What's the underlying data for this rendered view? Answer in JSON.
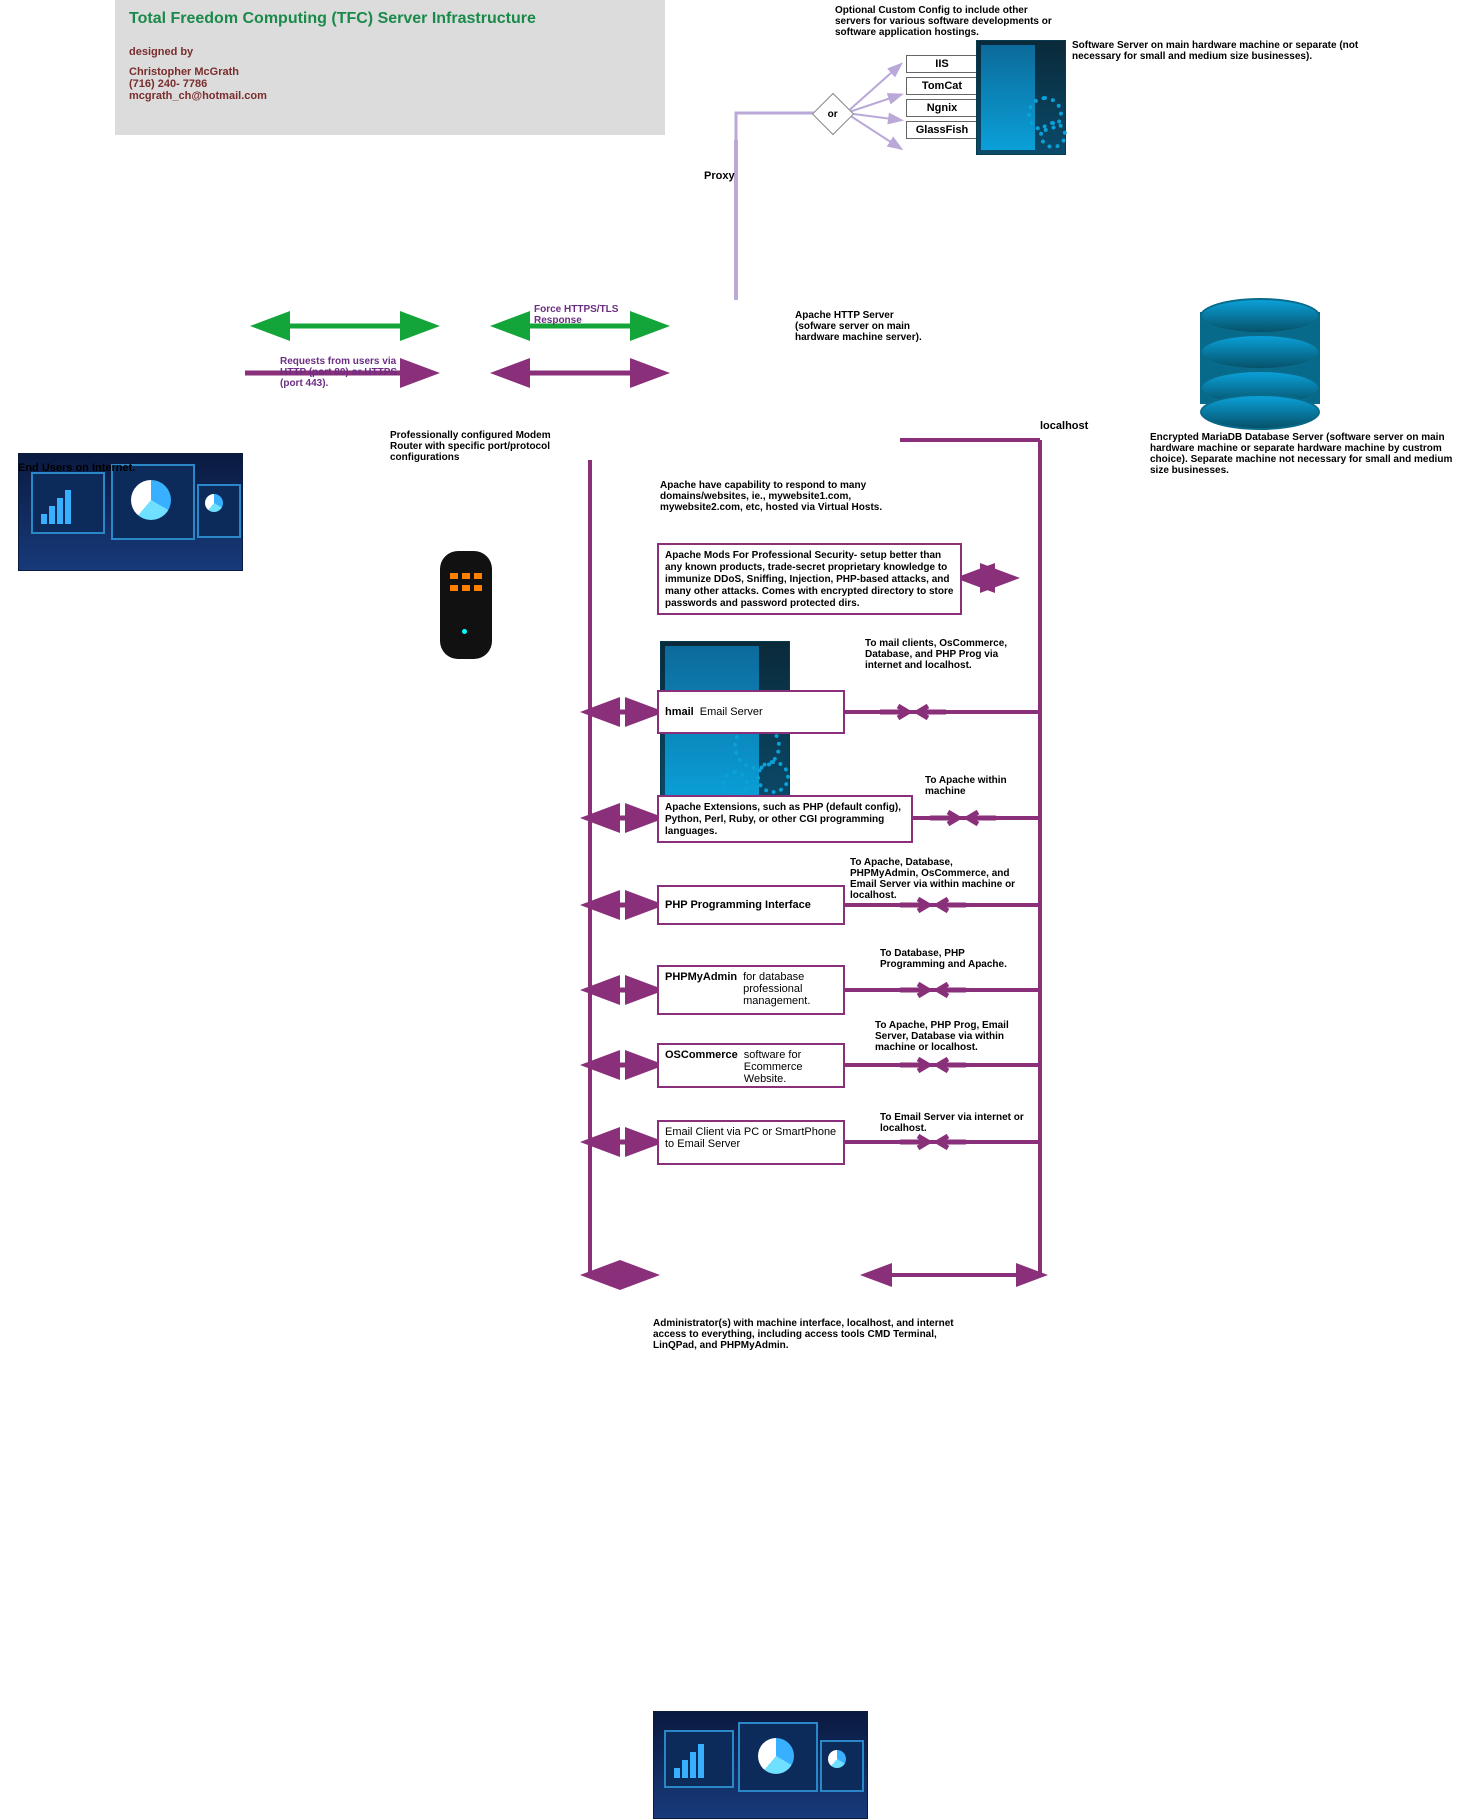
{
  "titlecard": {
    "title": "Total Freedom Computing (TFC) Server Infrastructure",
    "designed_by": "designed by",
    "name": "Christopher McGrath",
    "phone": "(716) 240- 7786",
    "email": "mcgrath_ch@hotmail.com"
  },
  "optional": {
    "heading": "Optional Custom Config to include other servers for various software developments or software application hostings.",
    "servers": [
      "IIS",
      "TomCat",
      "Ngnix",
      "GlassFish"
    ],
    "or": "or",
    "tower_caption": "Software Server on main hardware machine or separate (not necessary for small and medium size businesses)."
  },
  "proxy_label": "Proxy",
  "end_users": "End Users on Internet.",
  "router_caption": "Professionally configured Modem Router with specific port/protocol configurations",
  "req_label": "Requests from users via HTTP (port 80) or HTTPS (port 443).",
  "force_label": "Force HTTPS/TLS Response",
  "apache": {
    "name": "Apache HTTP Server (sofware server on main hardware machine server).",
    "cap1": "Apache have capability to respond to many domains/websites, ie., mywebsite1.com, mywebsite2.com, etc, hosted via Virtual Hosts.",
    "mods": "Apache Mods For Professional Security- setup better than any known products, trade-secret proprietary knowledge to immunize DDoS, Sniffing, Injection, PHP-based attacks, and many other attacks. Comes with encrypted directory to store passwords and password protected dirs."
  },
  "localhost": "localhost",
  "db_caption": "Encrypted MariaDB Database Server (software server on main hardware machine or separate hardware machine by custrom choice). Separate machine not necessary for small and medium size businesses.",
  "hmail": {
    "name": "hmail",
    "sub": "Email Server",
    "right": "To mail clients, OsCommerce, Database, and PHP Prog via internet and localhost."
  },
  "apache_ext": {
    "text": "Apache Extensions, such as PHP (default config), Python, Perl, Ruby, or other CGI programming languages.",
    "right": "To Apache within machine"
  },
  "phpprog": {
    "name": "PHP Programming Interface",
    "right": "To Apache, Database, PHPMyAdmin, OsCommerce, and Email Server via within machine or localhost."
  },
  "phpmyadmin": {
    "name": "PHPMyAdmin",
    "sub": "for database professional management.",
    "right": "To Database, PHP Programming and Apache."
  },
  "oscommerce": {
    "name": "OSCommerce",
    "sub": "software for Ecommerce Website.",
    "right": "To Apache, PHP Prog, Email Server, Database via within machine or localhost."
  },
  "emailclient": {
    "text": "Email Client via PC or SmartPhone to Email Server",
    "right": "To Email Server via internet or localhost."
  },
  "admin": "Administrator(s) with machine interface, localhost, and internet access to everything, including access tools CMD Terminal, LinQPad, and PHPMyAdmin."
}
